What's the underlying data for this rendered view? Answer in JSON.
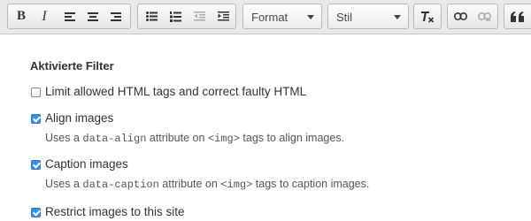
{
  "toolbar": {
    "bold_glyph": "B",
    "italic_glyph": "I",
    "format_label": "Format",
    "style_label": "Stil",
    "icons": [
      "bold-icon",
      "italic-icon",
      "align-left-icon",
      "align-center-icon",
      "align-right-icon",
      "bullet-list-icon",
      "numbered-list-icon",
      "outdent-icon",
      "indent-icon",
      "remove-format-icon",
      "link-icon",
      "unlink-icon",
      "blockquote-icon"
    ]
  },
  "filters": {
    "heading": "Aktivierte Filter",
    "items": [
      {
        "label": "Limit allowed HTML tags and correct faulty HTML",
        "checked": false
      },
      {
        "label": "Align images",
        "checked": true,
        "desc_before": "Uses a ",
        "desc_code": "data-align",
        "desc_middle": " attribute on ",
        "desc_tag": "<img>",
        "desc_after": " tags to align images."
      },
      {
        "label": "Caption images",
        "checked": true,
        "desc_before": "Uses a ",
        "desc_code": "data-caption",
        "desc_middle": " attribute on ",
        "desc_tag": "<img>",
        "desc_after": " tags to caption images."
      },
      {
        "label": "Restrict images to this site",
        "checked": true
      }
    ]
  },
  "colors": {
    "toolbar_bg": "#e9e9e9",
    "checkbox_checked": "#3b8fde",
    "text": "#333333"
  }
}
